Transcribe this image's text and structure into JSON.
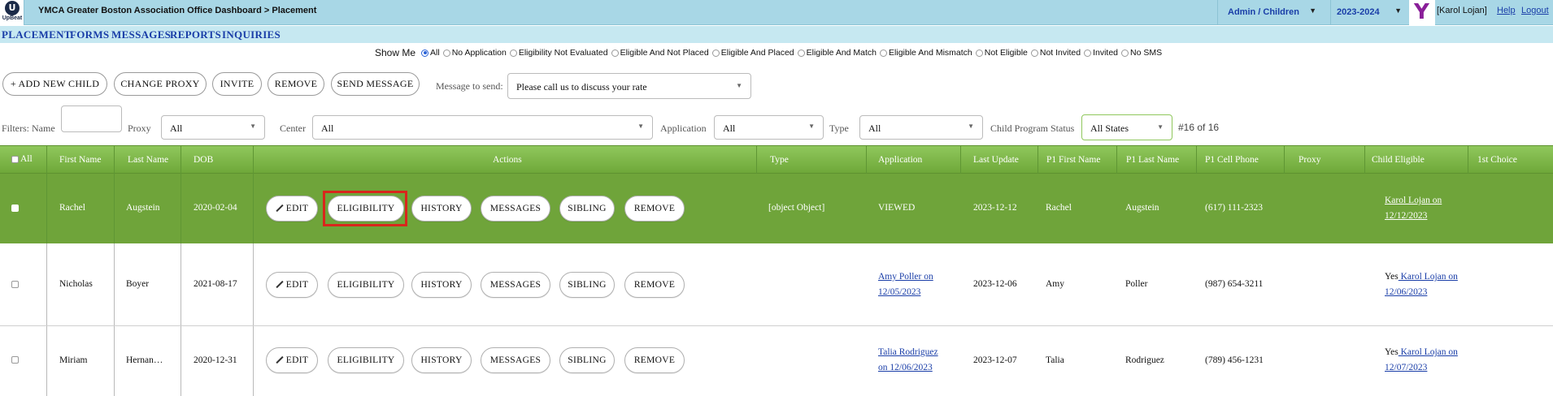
{
  "header": {
    "logo_text": "UpBeat",
    "title": "YMCA Greater Boston Association Office Dashboard > Placement",
    "role_select": "Admin / Children",
    "year_select": "2023-2024",
    "ymca_logo": "Y",
    "user": "[Karol Lojan]",
    "help": "Help",
    "logout": "Logout"
  },
  "nav": {
    "items": [
      "PLACEMENT",
      "FORMS",
      "MESSAGES",
      "REPORTS",
      "INQUIRIES"
    ]
  },
  "show_me": {
    "label": "Show Me",
    "selected": "All",
    "options": [
      "All",
      "No Application",
      "Eligibility Not Evaluated",
      "Eligible And Not Placed",
      "Eligible And Placed",
      "Eligible And Match",
      "Eligible And Mismatch",
      "Not Eligible",
      "Not Invited",
      "Invited",
      "No SMS"
    ]
  },
  "toolbar": {
    "add_child": "+ ADD NEW CHILD",
    "change_proxy": "CHANGE PROXY",
    "invite": "INVITE",
    "remove": "REMOVE",
    "send_message": "SEND MESSAGE",
    "message_label": "Message to send:",
    "message_value": "Please call us to discuss your rate"
  },
  "filters": {
    "name_label": "Filters: Name",
    "name_value": "",
    "proxy_label": "Proxy",
    "proxy_value": "All",
    "center_label": "Center",
    "center_value": "All",
    "application_label": "Application",
    "application_value": "All",
    "type_label": "Type",
    "type_value": "All",
    "status_label": "Child Program Status",
    "status_value": "All States",
    "count": "#16 of 16"
  },
  "table": {
    "columns": [
      "All",
      "First Name",
      "Last Name",
      "DOB",
      "Actions",
      "Type",
      "Application",
      "Last Update",
      "P1 First Name",
      "P1 Last Name",
      "P1 Cell Phone",
      "Proxy",
      "Child Eligible",
      "1st Choice"
    ],
    "actions": [
      "EDIT",
      "ELIGIBILITY",
      "HISTORY",
      "MESSAGES",
      "SIBLING",
      "REMOVE"
    ],
    "rows": [
      {
        "first": "Rachel",
        "last": "Augstein",
        "dob": "2020-02-04",
        "type": "[object Object]",
        "application_line1": "VIEWED",
        "application_line2": "",
        "last_update": "2023-12-12",
        "p1_first": "Rachel",
        "p1_last": "Augstein",
        "p1_phone": "(617) 111-2323",
        "proxy": "",
        "eligible_prefix": "",
        "eligible_line1": "Karol Lojan on",
        "eligible_line2": "12/12/2023",
        "first_choice": ""
      },
      {
        "first": "Nicholas",
        "last": "Boyer",
        "dob": "2021-08-17",
        "type": "",
        "application_line1": "Amy Poller on",
        "application_line2": "12/05/2023",
        "last_update": "2023-12-06",
        "p1_first": "Amy",
        "p1_last": "Poller",
        "p1_phone": "(987) 654-3211",
        "proxy": "",
        "eligible_prefix": "Yes",
        "eligible_line1": " Karol Lojan on",
        "eligible_line2": "12/06/2023",
        "first_choice": ""
      },
      {
        "first": "Miriam",
        "last": "Hernan…",
        "dob": "2020-12-31",
        "type": "",
        "application_line1": "Talia Rodriguez",
        "application_line2": "on 12/06/2023",
        "last_update": "2023-12-07",
        "p1_first": "Talia",
        "p1_last": "Rodriguez",
        "p1_phone": "(789) 456-1231",
        "proxy": "",
        "eligible_prefix": "Yes",
        "eligible_line1": " Karol Lojan on",
        "eligible_line2": "12/07/2023",
        "first_choice": ""
      }
    ]
  },
  "colors": {
    "topbar": "#a8d7e6",
    "navbar": "#c6e8f1",
    "header_green": "#7bb547",
    "selected_row": "#6fa43a",
    "link": "#1a3ea8",
    "highlight": "#d9261c"
  }
}
